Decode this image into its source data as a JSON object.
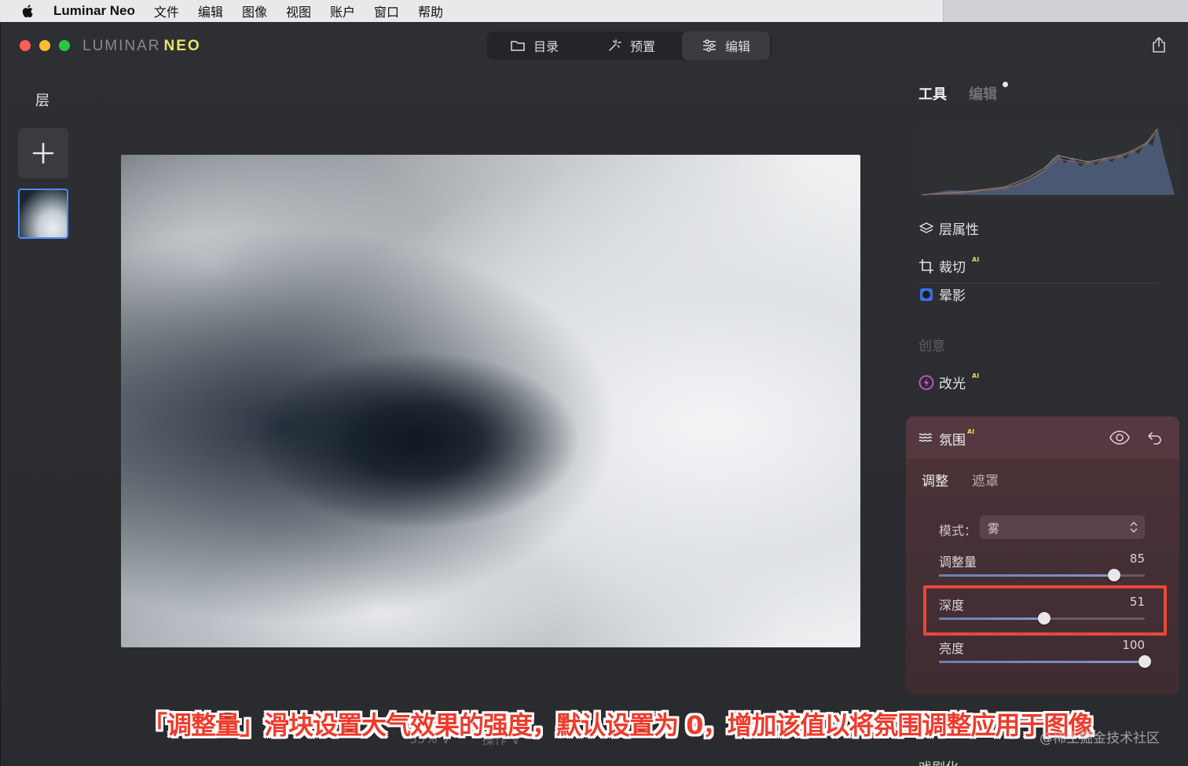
{
  "menubar": {
    "app_name": "Luminar Neo",
    "items": [
      "文件",
      "编辑",
      "图像",
      "视图",
      "账户",
      "窗口",
      "帮助"
    ]
  },
  "window": {
    "logo_left": "LUMINAR",
    "logo_right": "NEO",
    "mode_tabs": [
      {
        "label": "目录",
        "icon": "folder-icon"
      },
      {
        "label": "预置",
        "icon": "sparkle-icon"
      },
      {
        "label": "编辑",
        "icon": "sliders-icon",
        "active": true
      }
    ]
  },
  "layers": {
    "title": "层"
  },
  "right_panel": {
    "tabs": {
      "tools": "工具",
      "edits": "编辑"
    },
    "tools": [
      {
        "label": "层属性",
        "icon": "layers-icon"
      },
      {
        "label": "裁切",
        "icon": "crop-icon",
        "ai": "AI"
      },
      {
        "label": "晕影",
        "icon": "vignette-icon"
      }
    ],
    "creative_section": "创意",
    "relight": {
      "label": "改光",
      "ai": "AI"
    },
    "atmosphere": {
      "title": "氛围",
      "ai": "AI",
      "subtabs": {
        "adjust": "调整",
        "mask": "遮罩"
      },
      "mode_label": "模式：",
      "mode_value": "雾",
      "sliders": [
        {
          "label": "调整量",
          "value": 85
        },
        {
          "label": "深度",
          "value": 51
        },
        {
          "label": "亮度",
          "value": 100
        }
      ]
    },
    "next_tool": "戏剧化"
  },
  "bottom_bar": {
    "zoom": "35% ∨",
    "actions": "操作 ∨"
  },
  "caption": "「调整量」滑块设置大气效果的强度，默认设置为 0，增加该值以将氛围调整应用于图像",
  "watermark": "@稀土掘金技术社区",
  "colors": {
    "accent_blue": "#4a8cff",
    "atmosphere_panel": "#4c3338",
    "highlight_red": "#e9473b",
    "ai_badge": "#f2d24c"
  }
}
